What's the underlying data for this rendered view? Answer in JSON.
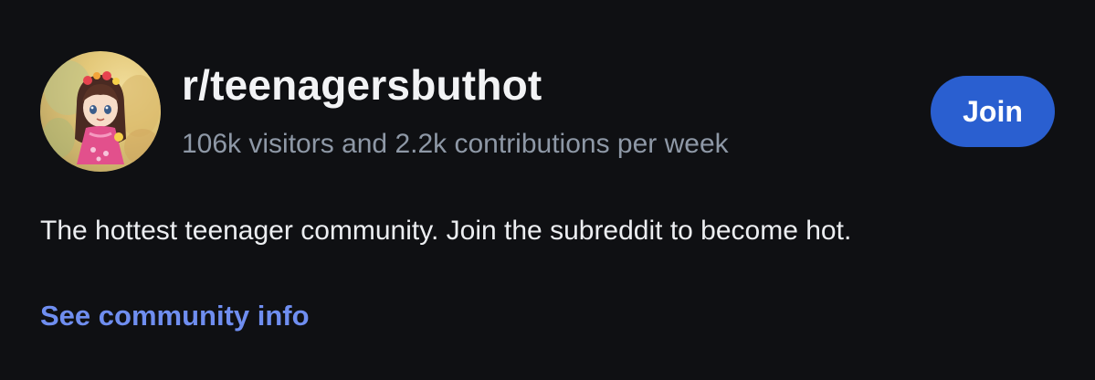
{
  "community": {
    "name": "r/teenagersbuthot",
    "stats": "106k visitors and 2.2k contributions per week",
    "description": "The hottest teenager community. Join the subreddit to become hot.",
    "avatar_icon": "community-avatar-illustration"
  },
  "actions": {
    "join_label": "Join",
    "info_link_label": "See community info"
  },
  "colors": {
    "background": "#0f1013",
    "title": "#f2f3f5",
    "stats": "#8e98a6",
    "join_button": "#2a5fd0",
    "link": "#6f8ef0"
  }
}
